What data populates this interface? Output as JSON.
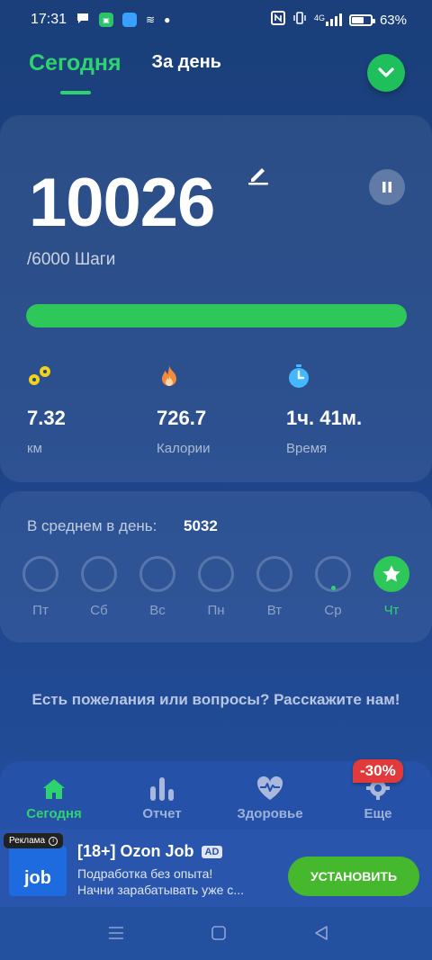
{
  "status_bar": {
    "time": "17:31",
    "signal_label": "4G",
    "battery_percent_text": "63%",
    "battery_level": 0.63
  },
  "header": {
    "tab_today": "Сегодня",
    "tab_day": "За день"
  },
  "main": {
    "steps": "10026",
    "goal_text": "/6000 Шаги",
    "progress": 1.0,
    "stats": [
      {
        "icon": "location-pins-icon",
        "value": "7.32",
        "label": "км",
        "color": "#f2d21b"
      },
      {
        "icon": "flame-icon",
        "value": "726.7",
        "label": "Калории",
        "color": "#f58a3a"
      },
      {
        "icon": "stopwatch-icon",
        "value": "1ч. 41м.",
        "label": "Время",
        "color": "#43b8ff"
      }
    ]
  },
  "week": {
    "avg_label": "В среднем в день:",
    "avg_value": "5032",
    "days": [
      {
        "name": "Пт"
      },
      {
        "name": "Сб"
      },
      {
        "name": "Вс"
      },
      {
        "name": "Пн"
      },
      {
        "name": "Вт"
      },
      {
        "name": "Ср"
      },
      {
        "name": "Чт"
      }
    ]
  },
  "feedback_text": "Есть пожелания или вопросы? Расскажите нам!",
  "bottom_nav": {
    "items": [
      {
        "label": "Сегодня",
        "icon": "home-icon"
      },
      {
        "label": "Отчет",
        "icon": "bar-chart-icon"
      },
      {
        "label": "Здоровье",
        "icon": "heart-pulse-icon"
      },
      {
        "label": "Еще",
        "icon": "gear-icon"
      }
    ],
    "discount": "-30%"
  },
  "ad": {
    "badge": "Реклама",
    "logo_text": "job",
    "title": "[18+] Ozon Job",
    "tag": "AD",
    "desc_line1": "Подработка без опыта!",
    "desc_line2": "Начни зарабатывать уже с...",
    "cta": "УСТАНОВИТЬ"
  },
  "colors": {
    "accent_green": "#2fd36e",
    "background": "#1e4488"
  }
}
